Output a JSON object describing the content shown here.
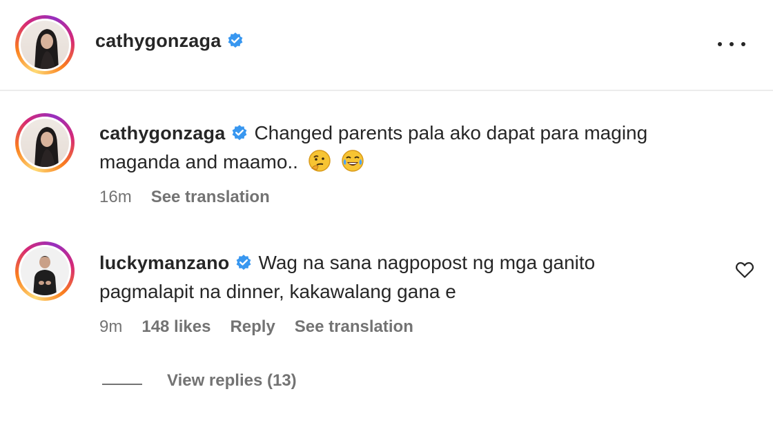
{
  "header": {
    "username": "cathygonzaga",
    "verified_icon": "verified-badge-icon",
    "more_icon": "more-options-icon"
  },
  "comments": [
    {
      "username": "cathygonzaga",
      "text_line1": "Changed parents pala ako dapat para maging",
      "text_line2": "maganda and maamo..",
      "emojis": [
        "thinking-face-emoji",
        "tears-of-joy-emoji"
      ],
      "time": "16m",
      "see_translation": "See translation"
    },
    {
      "username": "luckymanzano",
      "text_line1": "Wag na sana nagpopost ng mga ganito",
      "text_line2": "pagmalapit na dinner, kakawalang gana e",
      "time": "9m",
      "likes": "148 likes",
      "reply": "Reply",
      "see_translation": "See translation",
      "like_icon": "heart-icon"
    }
  ],
  "view_replies": "View replies (13)",
  "colors": {
    "verified_blue": "#3897f0",
    "meta_gray": "#737373",
    "text": "#262626"
  }
}
